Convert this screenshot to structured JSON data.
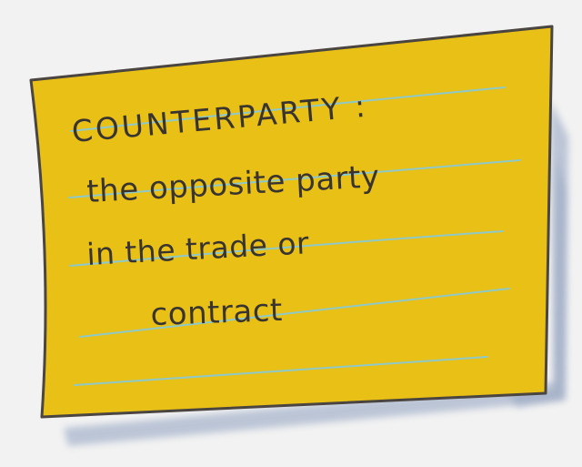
{
  "note": {
    "lines": [
      "COUNTERPARTY :",
      "the opposite party",
      "in the trade or",
      "contract"
    ]
  },
  "colors": {
    "background": "#f2f2f2",
    "note_fill": "#e8c016",
    "note_outline": "#4b4541",
    "ruled_lines": "#8fc9c7",
    "shadow": "#8fa0bf",
    "ink": "#3a3430"
  }
}
